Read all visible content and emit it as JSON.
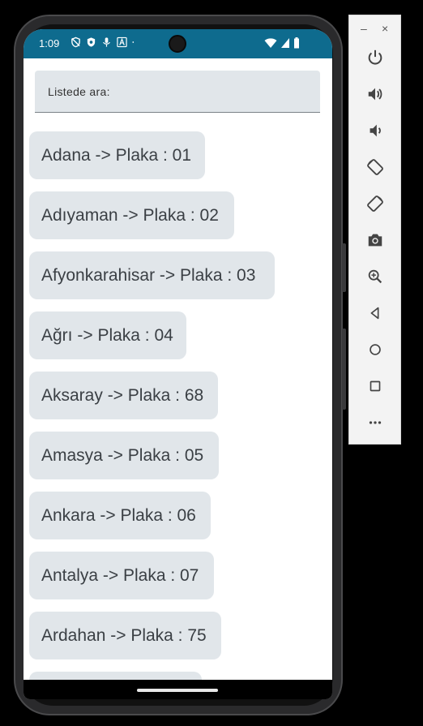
{
  "status_bar": {
    "time": "1:09",
    "background": "#0e6b8e"
  },
  "search": {
    "label": "Listede ara:"
  },
  "list_items": [
    "Adana -> Plaka : 01",
    "Adıyaman -> Plaka : 02",
    "Afyonkarahisar -> Plaka : 03",
    "Ağrı -> Plaka : 04",
    "Aksaray -> Plaka : 68",
    "Amasya -> Plaka : 05",
    "Ankara -> Plaka : 06",
    "Antalya -> Plaka : 07",
    "Ardahan -> Plaka : 75",
    ""
  ],
  "emulator_panel": {
    "minimize": "–",
    "close": "×",
    "buttons": [
      "power-icon",
      "volume-up-icon",
      "volume-down-icon",
      "rotate-left-icon",
      "rotate-right-icon",
      "camera-icon",
      "zoom-icon",
      "back-icon",
      "home-icon",
      "overview-icon",
      "more-icon"
    ]
  }
}
